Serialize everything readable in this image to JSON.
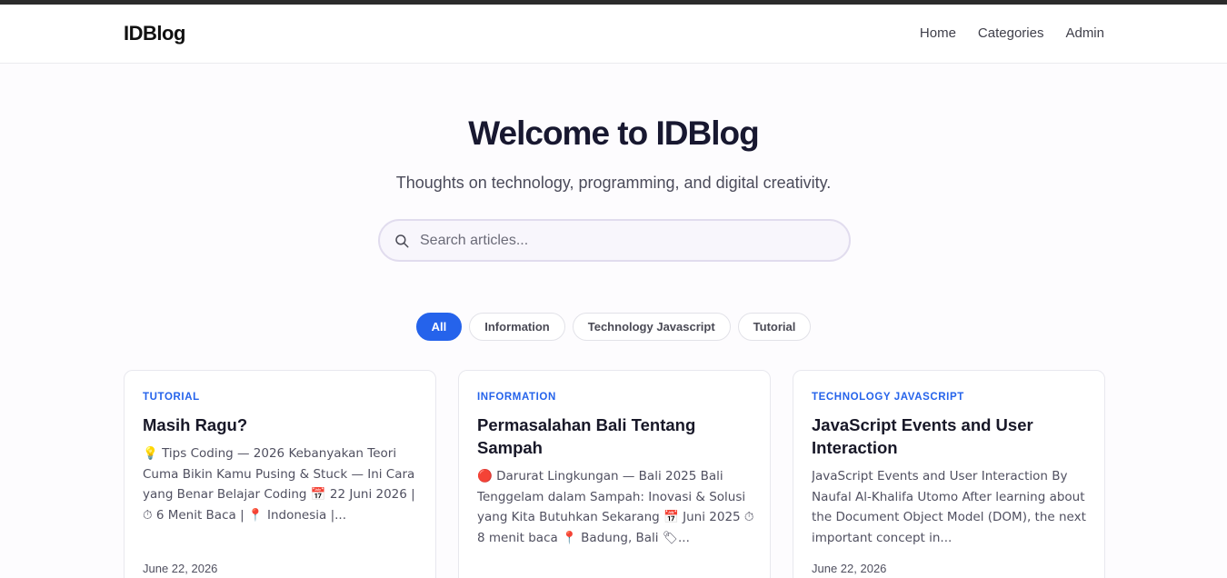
{
  "brand": "IDBlog",
  "nav": {
    "items": [
      "Home",
      "Categories",
      "Admin"
    ]
  },
  "hero": {
    "title": "Welcome to IDBlog",
    "subtitle": "Thoughts on technology, programming, and digital creativity."
  },
  "search": {
    "placeholder": "Search articles...",
    "value": ""
  },
  "filters": {
    "active": "All",
    "items": [
      "All",
      "Information",
      "Technology Javascript",
      "Tutorial"
    ]
  },
  "cards": [
    {
      "category": "TUTORIAL",
      "title": "Masih Ragu?",
      "excerpt": "💡 Tips Coding — 2026 Kebanyakan Teori Cuma Bikin Kamu Pusing & Stuck — Ini Cara yang Benar Belajar Coding 📅 22 Juni 2026 | ⏱ 6 Menit Baca | 📍 Indonesia |...",
      "date": "June 22, 2026"
    },
    {
      "category": "INFORMATION",
      "title": "Permasalahan Bali Tentang Sampah",
      "excerpt": "🔴 Darurat Lingkungan — Bali 2025 Bali Tenggelam dalam Sampah: Inovasi & Solusi yang Kita Butuhkan Sekarang 📅 Juni 2025 ⏱ 8 menit baca 📍 Badung, Bali 🏷...",
      "date": ""
    },
    {
      "category": "TECHNOLOGY JAVASCRIPT",
      "title": "JavaScript Events and User Interaction",
      "excerpt": "JavaScript Events and User Interaction By Naufal Al-Khalifa Utomo After learning about the Document Object Model (DOM), the next important concept in...",
      "date": "June 22, 2026"
    }
  ],
  "colors": {
    "accent": "#2563eb",
    "text": "#181830"
  }
}
